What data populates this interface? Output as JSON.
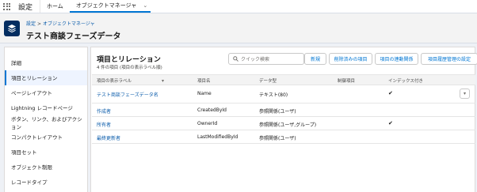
{
  "app": {
    "name": "設定",
    "tabs": [
      {
        "label": "ホーム"
      },
      {
        "label": "オブジェクトマネージャ"
      }
    ]
  },
  "header": {
    "breadcrumb": [
      "設定",
      "オブジェクトマネージャ"
    ],
    "title": "テスト商談フェーズデータ"
  },
  "sidebar": {
    "items": [
      {
        "label": "詳細"
      },
      {
        "label": "項目とリレーション"
      },
      {
        "label": "ページレイアウト"
      },
      {
        "label": "Lightning レコードページ"
      },
      {
        "label": "ボタン、リンク、およびアクション"
      },
      {
        "label": "コンパクトレイアウト"
      },
      {
        "label": "項目セット"
      },
      {
        "label": "オブジェクト制限"
      },
      {
        "label": "レコードタイプ"
      }
    ]
  },
  "main": {
    "title": "項目とリレーション",
    "subtitle": "4 件の項目 (項目の表示ラベル順)",
    "search_placeholder": "クイック検索",
    "buttons": [
      {
        "label": "新規"
      },
      {
        "label": "削除済みの項目"
      },
      {
        "label": "項目の連動関係"
      },
      {
        "label": "項目履歴管理の設定"
      }
    ],
    "columns": {
      "label": "項目の表示ラベル",
      "api": "項目名",
      "type": "データ型",
      "control": "制御項目",
      "indexed": "インデックス付き"
    },
    "rows": [
      {
        "label": "テスト商談フェーズデータ名",
        "api": "Name",
        "type": "テキスト(80)",
        "indexed": "✔"
      },
      {
        "label": "作成者",
        "api": "CreatedById",
        "type": "参照関係(ユーザ)",
        "indexed": ""
      },
      {
        "label": "所有者",
        "api": "OwnerId",
        "type": "参照関係(ユーザ,グループ)",
        "indexed": "✔"
      },
      {
        "label": "最終更新者",
        "api": "LastModifiedById",
        "type": "参照関係(ユーザ)",
        "indexed": ""
      }
    ]
  },
  "colors": {
    "brand": "#0176d3",
    "link": "#0b5cab",
    "header_icon": "#032d60"
  },
  "icons": {
    "launcher": "app-launcher-icon",
    "tab_menu": "chevron-down-icon",
    "object": "layers-icon",
    "search": "search-icon",
    "sort": "arrow-down-icon",
    "row_menu": "chevron-down-icon"
  }
}
